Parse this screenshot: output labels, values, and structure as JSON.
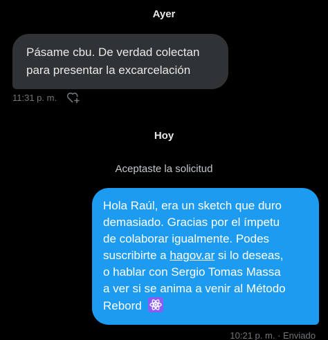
{
  "separators": {
    "yesterday": "Ayer",
    "today": "Hoy"
  },
  "incoming": {
    "text_line1": "Pásame cbu. De verdad colectan",
    "text_line2": "para presentar la excarcelación",
    "time": "11:31 p. m.",
    "react_icon": "heart-plus-icon"
  },
  "system_note": "Aceptaste la solicitud",
  "outgoing": {
    "line1": "Hola Raúl, era un sketch que duro",
    "line2": "demasiado. Gracias por el ímpetu",
    "line3": "de colaborar igualmente. Podes",
    "line4_pre": "suscribirte a ",
    "line4_link": "hagov.ar",
    "line4_post": " si lo deseas,",
    "line5": "o hablar con Sergio Tomas Massa",
    "line6": "a ver si se anima a venir al Método",
    "line7": "Rebord",
    "emoji_icon": "atom-emoji-icon",
    "time": "10:21 p. m.",
    "status": "Enviado"
  },
  "colors": {
    "background": "#000000",
    "incoming_bubble": "#2f3336",
    "outgoing_bubble": "#1d9bf0",
    "muted_text": "#71767b",
    "emoji_bg": "#8b5cf6"
  }
}
